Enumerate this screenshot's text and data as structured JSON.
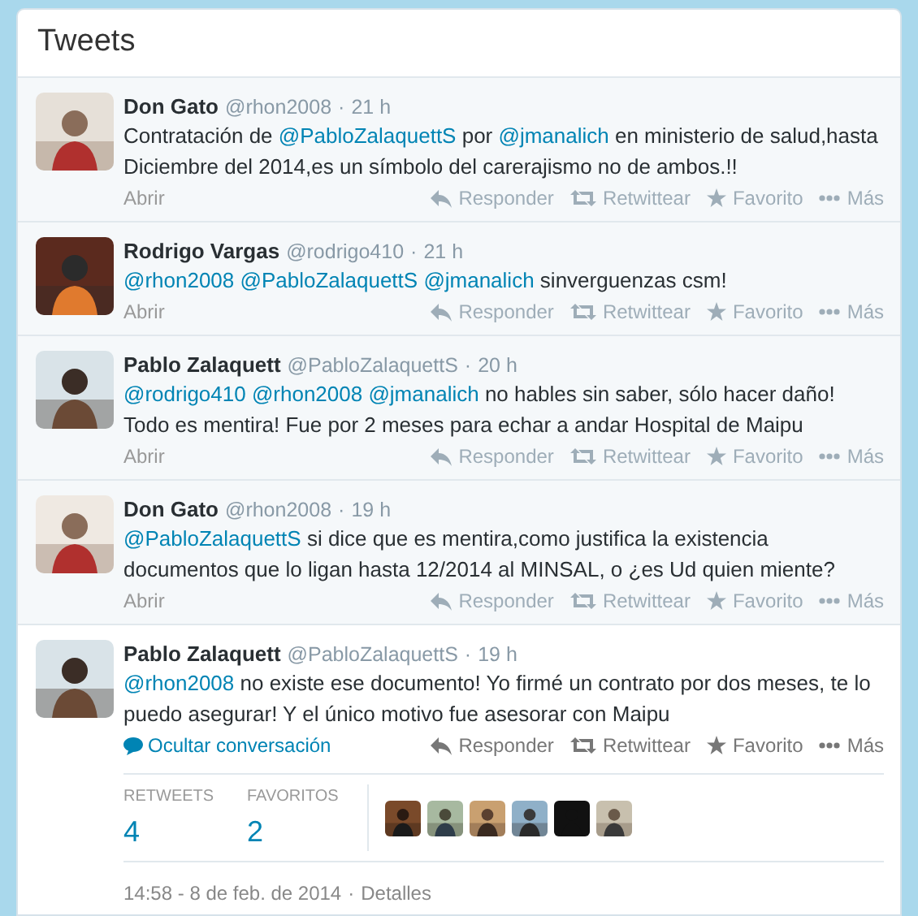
{
  "panel": {
    "title": "Tweets"
  },
  "tweets": [
    {
      "name": "Don Gato",
      "handle": "@rhon2008",
      "separator": "·",
      "time": "21 h",
      "avatar": {
        "kind": "picture"
      },
      "text": [
        {
          "kind": "text",
          "text": "Contratación de "
        },
        {
          "kind": "mention",
          "text": "@PabloZalaquettS"
        },
        {
          "kind": "text",
          "text": " por "
        },
        {
          "kind": "mention",
          "text": "@jmanalich"
        },
        {
          "kind": "text",
          "text": " en ministerio de salud,hasta Diciembre del 2014,es un símbolo del carerajismo no de ambos.!!"
        }
      ],
      "footer_link": {
        "kind": "open",
        "text": "Abrir"
      },
      "actions_faded": true,
      "actions": [
        "Responder",
        "Retwittear",
        "Favorito",
        "Más"
      ],
      "expanded": false
    },
    {
      "name": "Rodrigo Vargas",
      "handle": "@rodrigo410",
      "separator": "·",
      "time": "21 h",
      "avatar": {
        "kind": "picture"
      },
      "text": [
        {
          "kind": "mention",
          "text": "@rhon2008 "
        },
        {
          "kind": "mention",
          "text": "@PabloZalaquettS "
        },
        {
          "kind": "mention",
          "text": "@jmanalich"
        },
        {
          "kind": "text",
          "text": " sinverguenzas csm!"
        }
      ],
      "footer_link": {
        "kind": "open",
        "text": "Abrir"
      },
      "actions_faded": true,
      "actions": [
        "Responder",
        "Retwittear",
        "Favorito",
        "Más"
      ],
      "expanded": false
    },
    {
      "name": "Pablo Zalaquett",
      "handle": "@PabloZalaquettS",
      "separator": "·",
      "time": "20 h",
      "avatar": {
        "kind": "picture"
      },
      "text": [
        {
          "kind": "mention",
          "text": "@rodrigo410 "
        },
        {
          "kind": "mention",
          "text": "@rhon2008 "
        },
        {
          "kind": "mention",
          "text": "@jmanalich"
        },
        {
          "kind": "text",
          "text": " no hables sin saber, sólo hacer daño! Todo es mentira! Fue por 2 meses para echar a andar Hospital de Maipu"
        }
      ],
      "footer_link": {
        "kind": "open",
        "text": "Abrir"
      },
      "actions_faded": true,
      "actions": [
        "Responder",
        "Retwittear",
        "Favorito",
        "Más"
      ],
      "expanded": false
    },
    {
      "name": "Don Gato",
      "handle": "@rhon2008",
      "separator": "·",
      "time": "19 h",
      "avatar": {
        "kind": "picture"
      },
      "text": [
        {
          "kind": "mention",
          "text": "@PabloZalaquettS"
        },
        {
          "kind": "text",
          "text": " si dice que es mentira,como justifica la existencia documentos que lo ligan hasta 12/2014 al MINSAL, o ¿es Ud quien miente?"
        }
      ],
      "footer_link": {
        "kind": "open",
        "text": "Abrir"
      },
      "actions_faded": true,
      "actions": [
        "Responder",
        "Retwittear",
        "Favorito",
        "Más"
      ],
      "expanded": false
    },
    {
      "name": "Pablo Zalaquett",
      "handle": "@PabloZalaquettS",
      "separator": "·",
      "time": "19 h",
      "avatar": {
        "kind": "picture"
      },
      "text": [
        {
          "kind": "mention",
          "text": "@rhon2008"
        },
        {
          "kind": "text",
          "text": " no existe ese documento! Yo firmé un contrato por dos meses, te lo puedo asegurar! Y el único motivo fue asesorar con Maipu"
        }
      ],
      "footer_link": {
        "kind": "hide",
        "text": "Ocultar conversación"
      },
      "actions_faded": false,
      "actions": [
        "Responder",
        "Retwittear",
        "Favorito",
        "Más"
      ],
      "expanded": true,
      "stats": [
        {
          "label": "RETWEETS",
          "value": "4"
        },
        {
          "label": "FAVORITOS",
          "value": "2"
        }
      ],
      "engagers": [
        {
          "kind": "picture"
        },
        {
          "kind": "picture"
        },
        {
          "kind": "picture"
        },
        {
          "kind": "picture"
        },
        {
          "kind": "picture"
        },
        {
          "kind": "picture"
        }
      ],
      "timestamp": "14:58 - 8 de feb. de 2014",
      "timestamp_separator": "·",
      "details_link": "Detalles"
    }
  ]
}
